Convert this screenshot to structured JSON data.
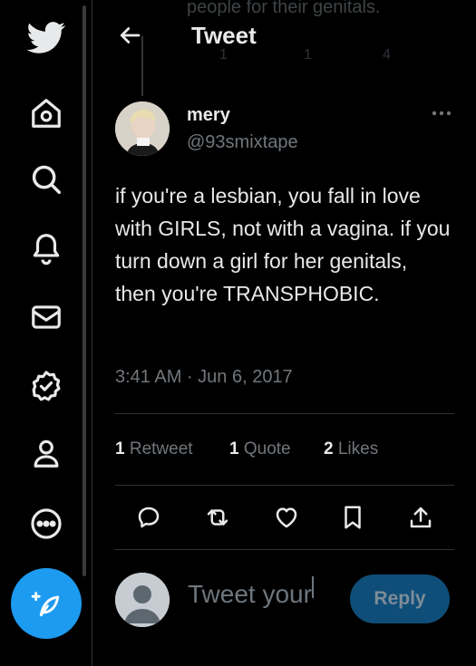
{
  "header": {
    "title": "Tweet"
  },
  "ghost_text": "people for their genitals.",
  "ghost_counts": {
    "replies": "1",
    "retweets": "1",
    "likes": "4"
  },
  "tweet": {
    "display_name": "mery",
    "handle": "@93smixtape",
    "text": "if you're a lesbian, you fall in love with GIRLS, not with a vagina. if you turn down a girl for her genitals, then you're TRANSPHOBIC.",
    "timestamp": "3:41 AM · Jun 6, 2017"
  },
  "stats": {
    "retweets_count": "1",
    "retweets_label": "Retweet",
    "quotes_count": "1",
    "quotes_label": "Quote",
    "likes_count": "2",
    "likes_label": "Likes"
  },
  "reply": {
    "placeholder": "Tweet your",
    "button": "Reply"
  },
  "colors": {
    "accent": "#1d9bf0",
    "background": "#000000",
    "text": "#e7e9ea",
    "muted": "#71767b",
    "divider": "#2f3336"
  },
  "sidebar_icons": [
    "twitter-logo-icon",
    "home-icon",
    "search-icon",
    "notifications-bell-icon",
    "messages-envelope-icon",
    "verified-badge-icon",
    "profile-person-icon",
    "more-circle-icon",
    "compose-feather-icon"
  ]
}
